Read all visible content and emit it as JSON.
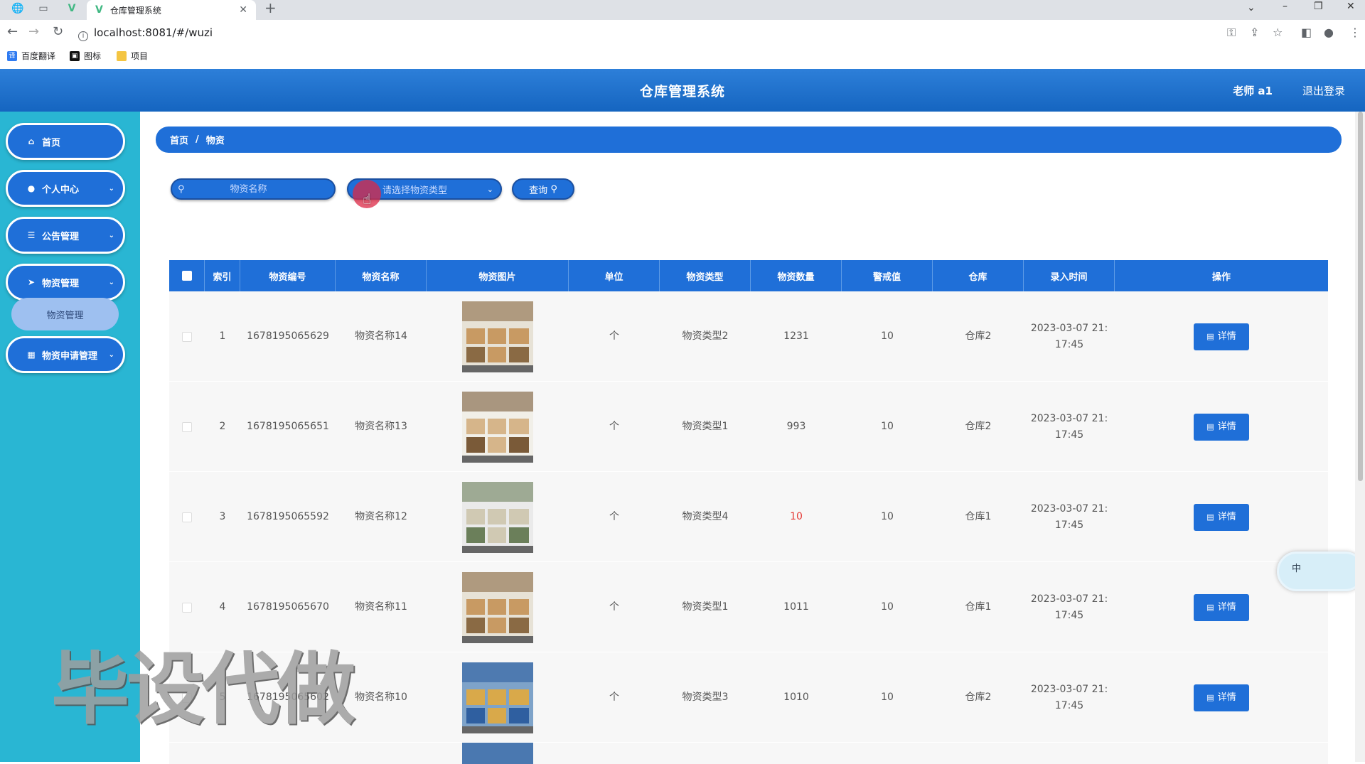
{
  "browser": {
    "tab_title": "仓库管理系统",
    "url": "localhost:8081/#/wuzi",
    "bookmarks": [
      "百度翻译",
      "图标",
      "项目"
    ]
  },
  "header": {
    "title": "仓库管理系统",
    "user": "老师 a1",
    "logout": "退出登录"
  },
  "sidebar": {
    "items": [
      {
        "label": "首页",
        "icon": "home-icon"
      },
      {
        "label": "个人中心",
        "icon": "user-icon"
      },
      {
        "label": "公告管理",
        "icon": "sliders-icon"
      },
      {
        "label": "物资管理",
        "icon": "send-icon"
      },
      {
        "label": "物资申请管理",
        "icon": "calendar-icon"
      }
    ],
    "active_sub": "物资管理"
  },
  "breadcrumb": {
    "home": "首页",
    "sep": "/",
    "current": "物资"
  },
  "search": {
    "name_placeholder": "物资名称",
    "type_placeholder": "请选择物资类型",
    "query_label": "查询"
  },
  "table": {
    "headers": [
      "索引",
      "物资编号",
      "物资名称",
      "物资图片",
      "单位",
      "物资类型",
      "物资数量",
      "警戒值",
      "仓库",
      "录入时间",
      "操作"
    ],
    "detail_label": "详情",
    "rows": [
      {
        "index": "1",
        "code": "1678195065629",
        "name": "物资名称14",
        "unit": "个",
        "type": "物资类型2",
        "qty": "1231",
        "alert": "10",
        "warehouse": "仓库2",
        "time1": "2023-03-07 21:",
        "time2": "17:45",
        "low": false
      },
      {
        "index": "2",
        "code": "1678195065651",
        "name": "物资名称13",
        "unit": "个",
        "type": "物资类型1",
        "qty": "993",
        "alert": "10",
        "warehouse": "仓库2",
        "time1": "2023-03-07 21:",
        "time2": "17:45",
        "low": false
      },
      {
        "index": "3",
        "code": "1678195065592",
        "name": "物资名称12",
        "unit": "个",
        "type": "物资类型4",
        "qty": "10",
        "alert": "10",
        "warehouse": "仓库1",
        "time1": "2023-03-07 21:",
        "time2": "17:45",
        "low": true
      },
      {
        "index": "4",
        "code": "1678195065670",
        "name": "物资名称11",
        "unit": "个",
        "type": "物资类型1",
        "qty": "1011",
        "alert": "10",
        "warehouse": "仓库1",
        "time1": "2023-03-07 21:",
        "time2": "17:45",
        "low": false
      },
      {
        "index": "5",
        "code": "1678195065602",
        "name": "物资名称10",
        "unit": "个",
        "type": "物资类型3",
        "qty": "1010",
        "alert": "10",
        "warehouse": "仓库2",
        "time1": "2023-03-07 21:",
        "time2": "17:45",
        "low": false
      }
    ]
  },
  "watermark": "毕设代做",
  "ime_label": "中",
  "colors": {
    "primary": "#1f6fd8",
    "sidebar": "#29b6d3",
    "warning": "#e53935"
  }
}
